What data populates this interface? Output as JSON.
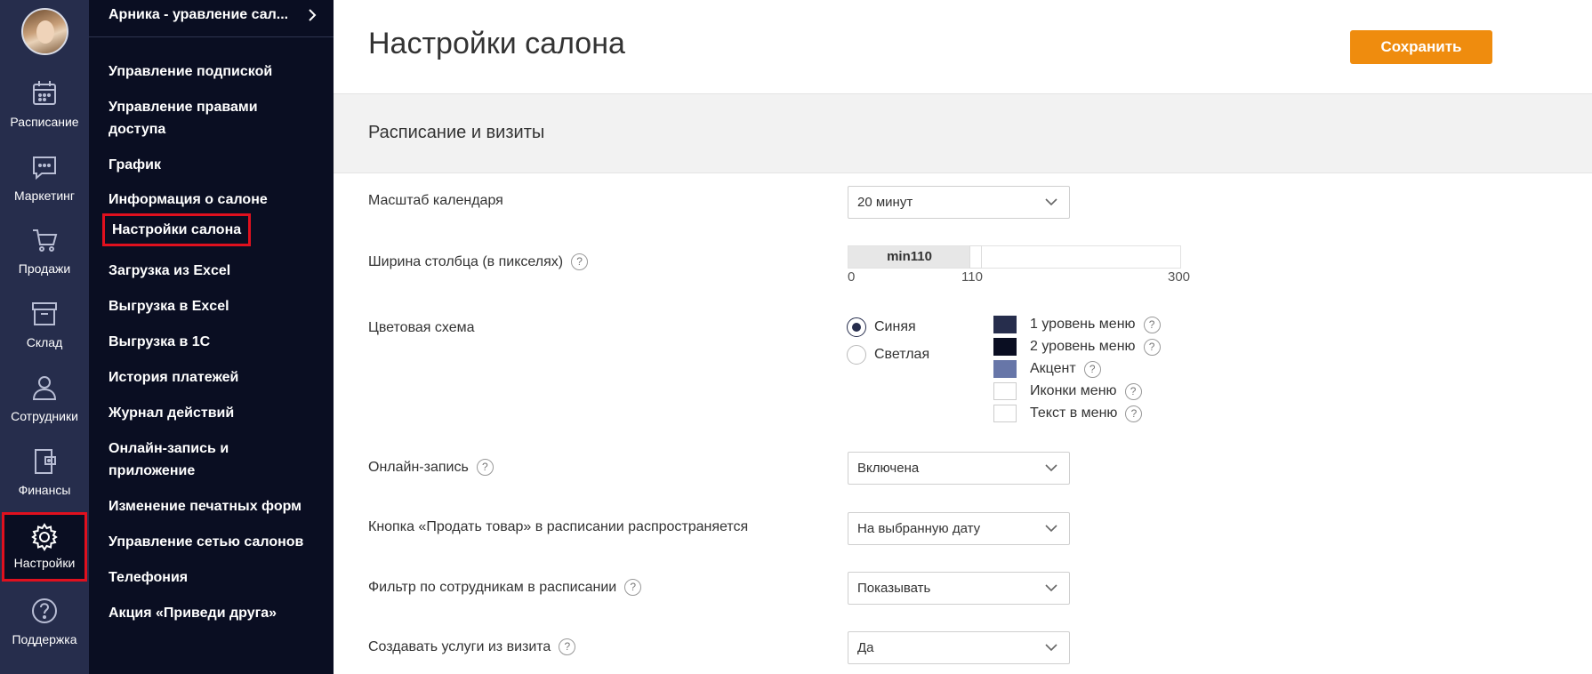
{
  "rail": {
    "items": [
      {
        "label": "Расписание",
        "icon": "calendar-icon"
      },
      {
        "label": "Маркетинг",
        "icon": "chat-icon"
      },
      {
        "label": "Продажи",
        "icon": "cart-icon"
      },
      {
        "label": "Склад",
        "icon": "box-icon"
      },
      {
        "label": "Сотрудники",
        "icon": "person-icon"
      },
      {
        "label": "Финансы",
        "icon": "wallet-icon"
      },
      {
        "label": "Настройки",
        "icon": "gear-icon"
      },
      {
        "label": "Поддержка",
        "icon": "help-circle-icon"
      }
    ],
    "active": "Настройки"
  },
  "submenu": {
    "salon_name": "Арника - уравление сал...",
    "items": [
      "Управление подпиской",
      "Управление правами",
      "доступа",
      "График",
      "Информация о салоне",
      "Настройки салона",
      "Загрузка из Excel",
      "Выгрузка в Excel",
      "Выгрузка в 1С",
      "История платежей",
      "Журнал действий",
      "Онлайн-запись и",
      "приложение",
      "Изменение печатных форм",
      "Управление сетью салонов",
      "Телефония",
      "Акция «Приведи друга»"
    ],
    "selected": "Настройки салона"
  },
  "page": {
    "title": "Настройки салона",
    "save_label": "Сохранить",
    "section_title": "Расписание и визиты"
  },
  "settings": {
    "calendar_scale": {
      "label": "Масштаб календаря",
      "value": "20 минут"
    },
    "column_width": {
      "label": "Ширина столбца (в пикселях)",
      "slider_text": "min110",
      "min": "0",
      "current": "110",
      "max": "300",
      "fraction": 0.3667
    },
    "color_scheme": {
      "label": "Цветовая схема",
      "options": [
        "Синяя",
        "Светлая"
      ],
      "selected": "Синяя",
      "swatches": [
        {
          "label": "1 уровень меню",
          "color": "#262d4c"
        },
        {
          "label": "2 уровень меню",
          "color": "#0a0e22"
        },
        {
          "label": "Акцент",
          "color": "#6776a8"
        },
        {
          "label": "Иконки меню",
          "color": "#ffffff"
        },
        {
          "label": "Текст в меню",
          "color": "#ffffff"
        }
      ]
    },
    "online_booking": {
      "label": "Онлайн-запись",
      "value": "Включена"
    },
    "sell_button": {
      "label": "Кнопка «Продать товар» в расписании распространяется",
      "value": "На выбранную дату"
    },
    "staff_filter": {
      "label": "Фильтр по сотрудникам в расписании",
      "value": "Показывать"
    },
    "create_services": {
      "label": "Создавать услуги из визита",
      "value": "Да"
    }
  }
}
